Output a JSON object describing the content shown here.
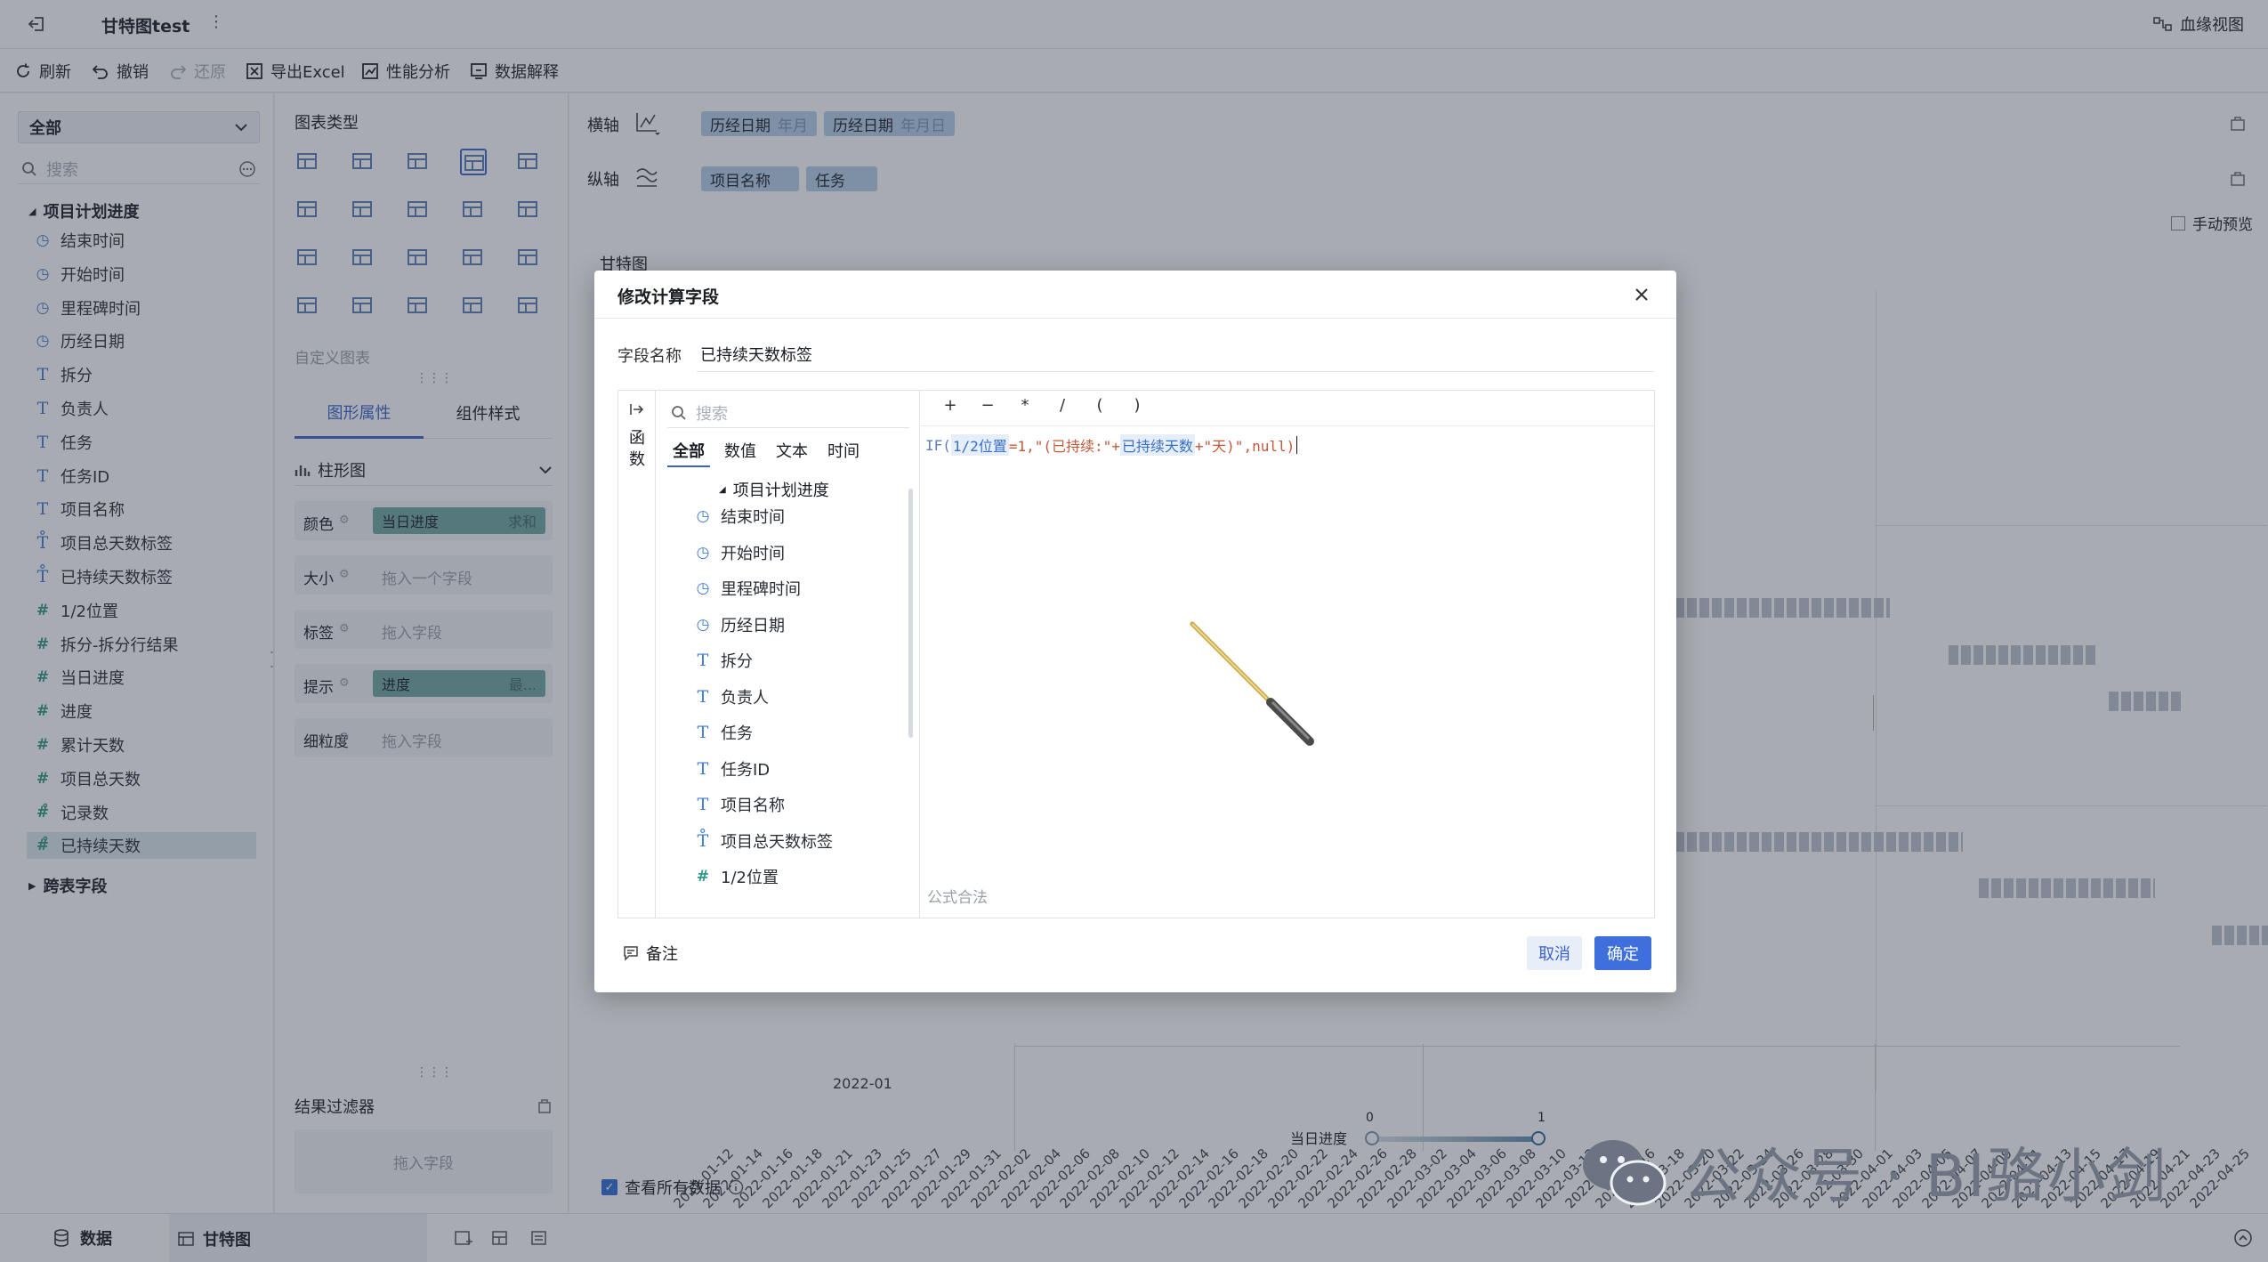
{
  "topbar": {
    "title": "甘特图test",
    "more": "⋮",
    "lineage": "血缘视图"
  },
  "toolbar": {
    "refresh": "刷新",
    "undo": "撤销",
    "redo": "还原",
    "export": "导出Excel",
    "perf": "性能分析",
    "explain": "数据解释"
  },
  "left": {
    "dropdown": "全部",
    "search_placeholder": "搜索",
    "group": "项目计划进度",
    "fields": [
      {
        "type": "time",
        "label": "结束时间"
      },
      {
        "type": "time",
        "label": "开始时间"
      },
      {
        "type": "time",
        "label": "里程碑时间"
      },
      {
        "type": "time",
        "label": "历经日期"
      },
      {
        "type": "text",
        "label": "拆分"
      },
      {
        "type": "text",
        "label": "负责人"
      },
      {
        "type": "text",
        "label": "任务"
      },
      {
        "type": "text",
        "label": "任务ID"
      },
      {
        "type": "text",
        "label": "项目名称"
      },
      {
        "type": "textcalc",
        "label": "项目总天数标签"
      },
      {
        "type": "textcalc",
        "label": "已持续天数标签"
      },
      {
        "type": "num",
        "label": "1/2位置"
      },
      {
        "type": "num",
        "label": "拆分-拆分行结果"
      },
      {
        "type": "num",
        "label": "当日进度"
      },
      {
        "type": "num",
        "label": "进度"
      },
      {
        "type": "num",
        "label": "累计天数"
      },
      {
        "type": "num",
        "label": "项目总天数"
      },
      {
        "type": "numcalc",
        "label": "记录数"
      },
      {
        "type": "numcalc",
        "label": "已持续天数"
      }
    ],
    "cross": "跨表字段"
  },
  "mid": {
    "chart_type": "图表类型",
    "custom": "自定义图表",
    "tab1": "图形属性",
    "tab2": "组件样式",
    "chart_kind": "柱形图",
    "props": [
      {
        "label": "颜色",
        "chip": "当日进度",
        "chip2": "求和"
      },
      {
        "label": "大小",
        "hint": "拖入一个字段"
      },
      {
        "label": "标签",
        "hint": "拖入字段"
      },
      {
        "label": "提示",
        "chip": "进度",
        "chip2": "最..."
      },
      {
        "label": "细粒度",
        "hint": "拖入字段"
      }
    ],
    "filter": "结果过滤器",
    "filter_hint": "拖入字段"
  },
  "main": {
    "xaxis": "横轴",
    "yaxis": "纵轴",
    "x_chips": [
      {
        "name": "历经日期",
        "sub": "年月"
      },
      {
        "name": "历经日期",
        "sub": "年月日"
      }
    ],
    "y_chips": [
      {
        "name": "项目名称"
      },
      {
        "name": "任务"
      }
    ],
    "manual": "手动预览",
    "chart_title": "甘特图",
    "month": "2022-01",
    "slider_label": "当日进度",
    "slider_min": "0",
    "slider_max": "1",
    "view_all": "查看所有数据",
    "dates": [
      "2022-01-12",
      "2022-01-14",
      "2022-01-16",
      "2022-01-18",
      "2022-01-21",
      "2022-01-23",
      "2022-01-25",
      "2022-01-27",
      "2022-01-29",
      "2022-01-31",
      "2022-02-02",
      "2022-02-04",
      "2022-02-06",
      "2022-02-08",
      "2022-02-10",
      "2022-02-12",
      "2022-02-14",
      "2022-02-16",
      "2022-02-18",
      "2022-02-20",
      "2022-02-22",
      "2022-02-24",
      "2022-02-26",
      "2022-02-28",
      "2022-03-02",
      "2022-03-04",
      "2022-03-06",
      "2022-03-08",
      "2022-03-10",
      "2022-03-12",
      "2022-03-14",
      "2022-03-16",
      "2022-03-18",
      "2022-03-20",
      "2022-03-22",
      "2022-03-24",
      "2022-03-26",
      "2022-03-28",
      "2022-03-30",
      "2022-04-01",
      "2022-04-03",
      "2022-04-05",
      "2022-04-07",
      "2022-04-09",
      "2022-04-11",
      "2022-04-13",
      "2022-04-15",
      "2022-04-17",
      "2022-04-19",
      "2022-04-21",
      "2022-04-23",
      "2022-04-25"
    ]
  },
  "bottom": {
    "data": "数据",
    "sheet": "甘特图"
  },
  "dialog": {
    "title": "修改计算字段",
    "name_label": "字段名称",
    "name_value": "已持续天数标签",
    "func_tab": "函数",
    "search_placeholder": "搜索",
    "filters": [
      "全部",
      "数值",
      "文本",
      "时间"
    ],
    "group": "项目计划进度",
    "fields": [
      {
        "type": "time",
        "label": "结束时间"
      },
      {
        "type": "time",
        "label": "开始时间"
      },
      {
        "type": "time",
        "label": "里程碑时间"
      },
      {
        "type": "time",
        "label": "历经日期"
      },
      {
        "type": "text",
        "label": "拆分"
      },
      {
        "type": "text",
        "label": "负责人"
      },
      {
        "type": "text",
        "label": "任务"
      },
      {
        "type": "text",
        "label": "任务ID"
      },
      {
        "type": "text",
        "label": "项目名称"
      },
      {
        "type": "textcalc",
        "label": "项目总天数标签"
      },
      {
        "type": "num",
        "label": "1/2位置"
      }
    ],
    "operators": [
      "+",
      "−",
      "*",
      "/",
      "(",
      ")"
    ],
    "formula": {
      "p1": "IF(",
      "f1": "1/2位置",
      "p2": "=1,\"(已持续:\"+",
      "f2": "已持续天数",
      "p3": "+\"天)\",null)"
    },
    "status": "公式合法",
    "note": "备注",
    "cancel": "取消",
    "confirm": "确定"
  },
  "watermark": "公众号 · BI骆小剑"
}
